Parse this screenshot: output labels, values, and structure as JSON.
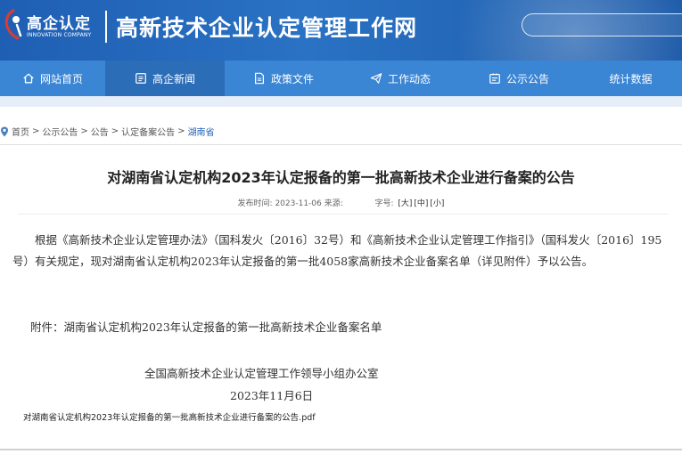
{
  "header": {
    "logo_text": "高企认定",
    "logo_subtext": "INNOVATION COMPANY",
    "site_title": "高新技术企业认定管理工作网",
    "search_placeholder": ""
  },
  "nav": {
    "items": [
      {
        "label": "网站首页",
        "icon": "home-icon",
        "active": false
      },
      {
        "label": "高企新闻",
        "icon": "news-icon",
        "active": true
      },
      {
        "label": "政策文件",
        "icon": "document-icon",
        "active": false
      },
      {
        "label": "工作动态",
        "icon": "paper-plane-icon",
        "active": false
      },
      {
        "label": "公示公告",
        "icon": "announcement-icon",
        "active": false
      },
      {
        "label": "统计数据",
        "icon": "",
        "active": false
      }
    ]
  },
  "breadcrumb": {
    "items": [
      "首页",
      "公示公告",
      "公告",
      "认定备案公告",
      "湖南省"
    ],
    "separator": ">"
  },
  "article": {
    "title": "对湖南省认定机构2023年认定报备的第一批高新技术企业进行备案的公告",
    "meta_publish_label": "发布时间:",
    "meta_publish_date": "2023-11-06",
    "meta_source_label": "来源:",
    "meta_font_label": "字号:",
    "font_sizes": [
      "[大]",
      "[中]",
      "[小]"
    ],
    "body": "根据《高新技术企业认定管理办法》（国科发火〔2016〕32号）和《高新技术企业认定管理工作指引》（国科发火〔2016〕195号）有关规定，现对湖南省认定机构2023年认定报备的第一批4058家高新技术企业备案名单（详见附件）予以公告。",
    "attachment_line": "附件：湖南省认定机构2023年认定报备的第一批高新技术企业备案名单",
    "signature": "全国高新技术企业认定管理工作领导小组办公室",
    "date": "2023年11月6日",
    "pdf_link": "对湖南省认定机构2023年认定报备的第一批高新技术企业进行备案的公告.pdf"
  },
  "colors": {
    "header_blue": "#1f5fb3",
    "nav_blue": "#3a85d4",
    "nav_active": "#2c6db8",
    "link_blue": "#1f5fb3",
    "logo_red": "#e03a2e"
  }
}
